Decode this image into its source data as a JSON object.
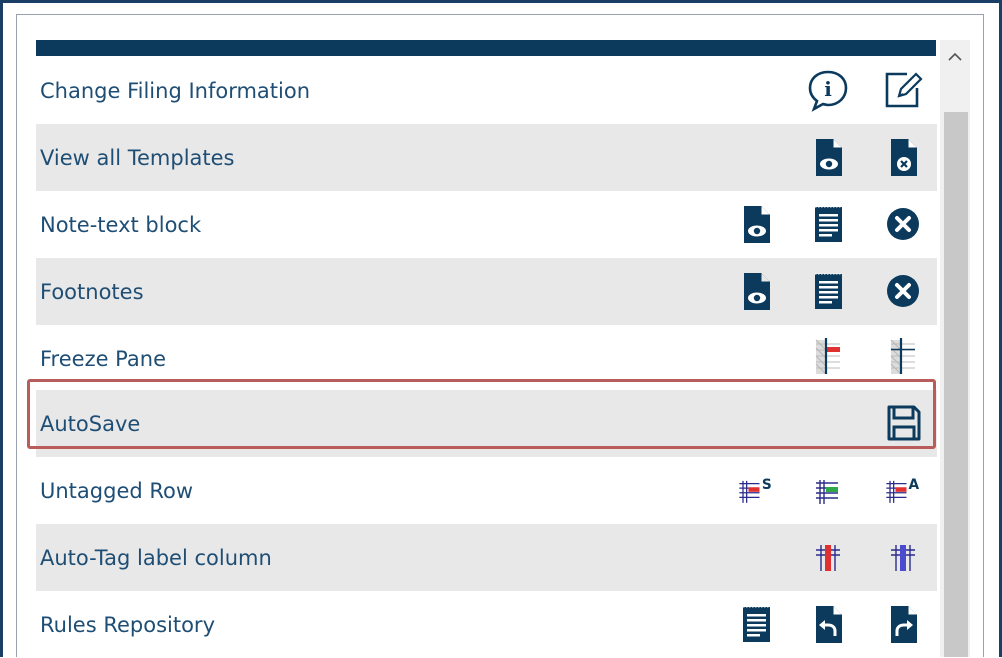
{
  "rows": [
    {
      "label": "Change Filing Information",
      "icons": [
        "info-speech-icon",
        "edit-icon"
      ]
    },
    {
      "label": "View all Templates",
      "icons": [
        "view-document-icon",
        "remove-document-icon"
      ]
    },
    {
      "label": "Note-text block",
      "icons": [
        "view-document-icon",
        "text-document-icon",
        "delete-circle-icon"
      ]
    },
    {
      "label": "Footnotes",
      "icons": [
        "view-document-icon",
        "text-document-icon",
        "delete-circle-icon"
      ]
    },
    {
      "label": "Freeze Pane",
      "icons": [
        "freeze-pane-red-icon",
        "freeze-pane-icon"
      ]
    },
    {
      "label": "AutoSave",
      "icons": [
        "save-icon"
      ]
    },
    {
      "label": "Untagged Row",
      "icons": [
        "untagged-row-s-icon",
        "untagged-row-green-icon",
        "untagged-row-a-icon"
      ]
    },
    {
      "label": "Auto-Tag label column",
      "icons": [
        "autotag-red-icon",
        "autotag-blue-icon"
      ]
    },
    {
      "label": "Rules Repository",
      "icons": [
        "text-document-icon",
        "undo-document-icon",
        "redo-document-icon"
      ]
    }
  ],
  "icon_glyphs": {
    "info": "i",
    "superscript_s": "S",
    "superscript_a": "A"
  },
  "colors": {
    "header_bar": "#0b3a5d",
    "label_text": "#1f4e75",
    "icon_navy": "#0b3a5d",
    "row_alt": "#e8e8e8",
    "highlight": "#b85c5c"
  }
}
